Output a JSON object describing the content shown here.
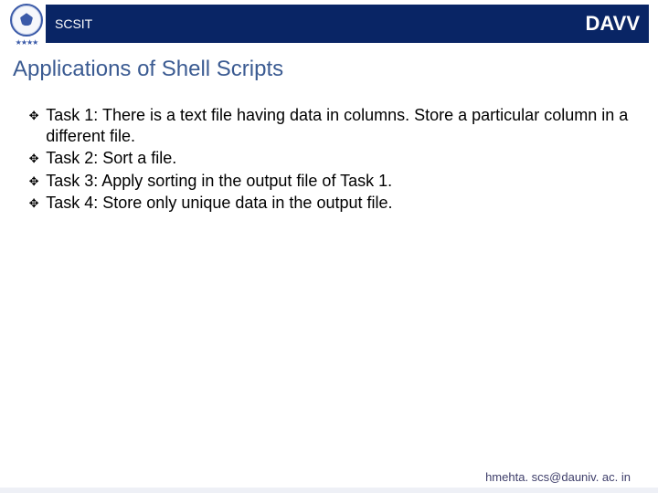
{
  "header": {
    "scsit": "SCSIT",
    "davv": "DAVV",
    "logo_stars": "★★★★"
  },
  "title": "Applications of Shell Scripts",
  "bullet_glyph": "✥",
  "bullets": [
    "Task 1: There is a text file having data in columns. Store a particular column in a different file.",
    "Task 2: Sort a file.",
    "Task 3: Apply sorting in the output file of Task 1.",
    "Task 4: Store only unique data in the output file."
  ],
  "footer": "hmehta. scs@dauniv. ac. in"
}
